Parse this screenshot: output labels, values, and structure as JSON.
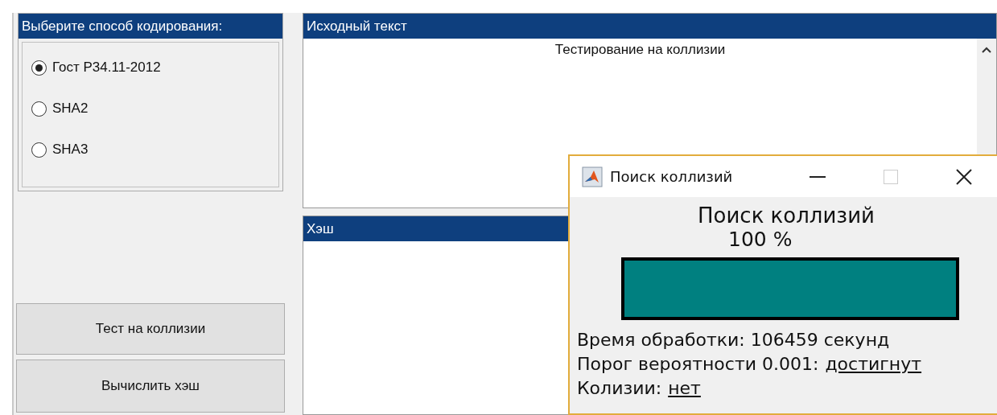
{
  "encoding_panel": {
    "title": "Выберите способ кодирования:",
    "options": [
      {
        "label": "Гост Р34.11-2012",
        "selected": true
      },
      {
        "label": "SHA2",
        "selected": false
      },
      {
        "label": "SHA3",
        "selected": false
      }
    ]
  },
  "buttons": [
    "Тест на коллизии",
    "Вычислить хэш"
  ],
  "source_panel": {
    "title": "Исходный текст",
    "text": "Тестирование на коллизии"
  },
  "hash_panel": {
    "title": "Хэш"
  },
  "dialog": {
    "title": "Поиск коллизий",
    "heading": "Поиск коллизий",
    "percent": "100 %",
    "progress": {
      "level": 1
    },
    "lines": [
      {
        "label": "Время обработки: 106459 секунд"
      },
      {
        "label": "Порог вероятности 0.001:",
        "value": "достигнут"
      },
      {
        "label": "Колизии:",
        "value": "нет"
      }
    ]
  }
}
